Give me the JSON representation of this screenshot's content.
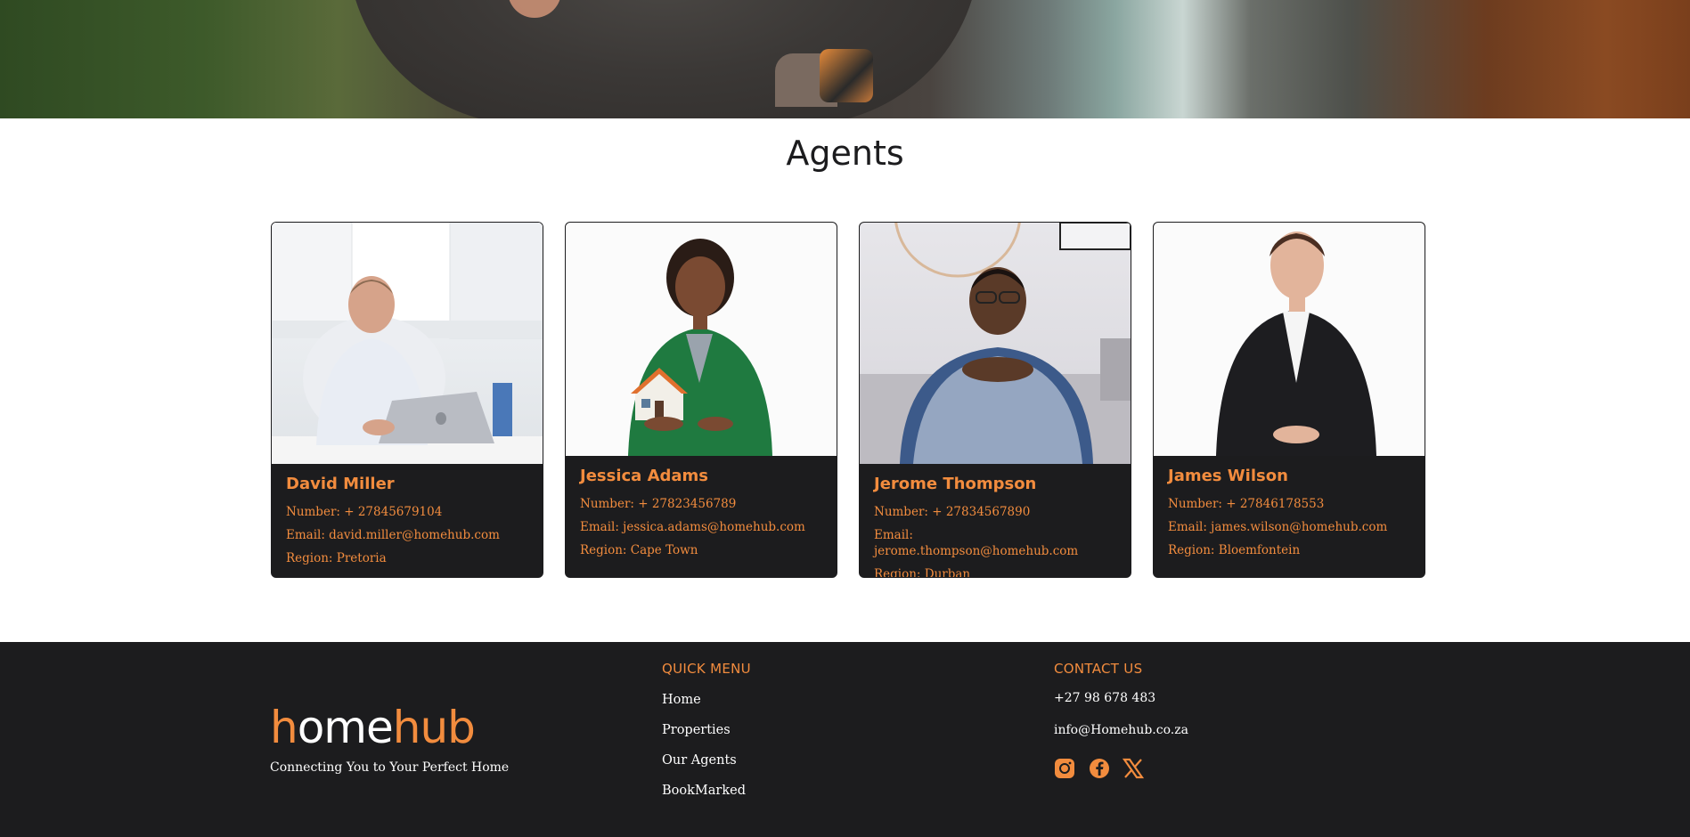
{
  "hero": {
    "image": "agent-hero-photo"
  },
  "section": {
    "title": "Agents"
  },
  "agents": [
    {
      "name": "David Miller",
      "number": "Number: + 27845679104",
      "email": "Email: david.miller@homehub.com",
      "region": "Region: Pretoria"
    },
    {
      "name": "Jessica Adams",
      "number": "Number: + 27823456789",
      "email": "Email: jessica.adams@homehub.com",
      "region": "Region: Cape Town"
    },
    {
      "name": "Jerome Thompson",
      "number": "Number: + 27834567890",
      "email": "Email: jerome.thompson@homehub.com",
      "region": "Region: Durban"
    },
    {
      "name": "James Wilson",
      "number": "Number: + 27846178553",
      "email": "Email: james.wilson@homehub.com",
      "region": "Region: Bloemfontein"
    }
  ],
  "footer": {
    "logo": {
      "part1": "h",
      "part2": "ome",
      "part3": "hub"
    },
    "tagline": "Connecting You to Your Perfect Home",
    "quick_menu": {
      "title": "QUICK MENU",
      "items": [
        "Home",
        "Properties",
        "Our Agents",
        "BookMarked"
      ]
    },
    "contact": {
      "title": "CONTACT US",
      "phone": "+27 98 678 483",
      "email": "info@Homehub.co.za",
      "social_icons": [
        "instagram-icon",
        "facebook-icon",
        "x-icon"
      ]
    }
  },
  "colors": {
    "accent": "#f28c3e",
    "dark": "#1c1c1e",
    "white": "#ffffff"
  }
}
